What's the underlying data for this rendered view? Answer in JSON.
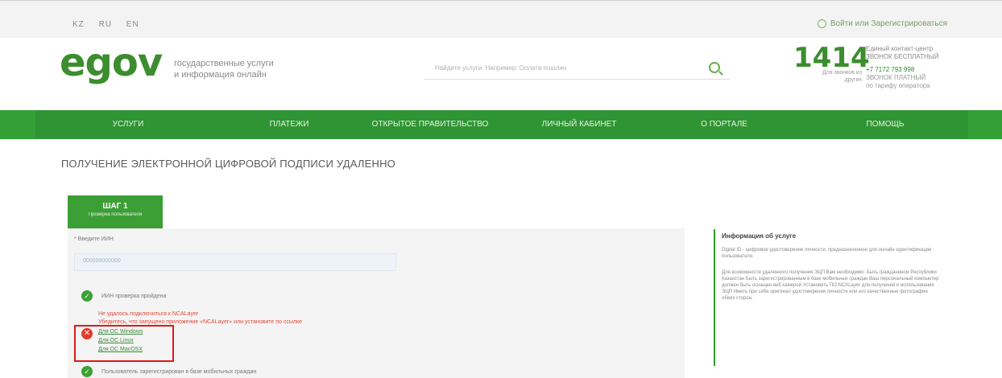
{
  "top": {
    "langs": [
      "KZ",
      "RU",
      "EN"
    ],
    "login": "Войти или Зарегистрироваться"
  },
  "header": {
    "logo_main": "egov",
    "tagline_1": "государственные услуги",
    "tagline_2": "и информация онлайн",
    "search_placeholder": "Найдите услуги. Например: Оплата пошлин",
    "phone": "1414",
    "phone_note_1": "Единый контакт-центр",
    "phone_note_2": "ЗВОНОК БЕСПЛАТНЫЙ",
    "phone_abroad_1": "Для звонков из",
    "phone_abroad_2": "других",
    "phone2": "+7 7172 793 998",
    "phone2_note_1": "ЗВОНОК ПЛАТНЫЙ",
    "phone2_note_2": "по тарифу оператора"
  },
  "nav": {
    "items": [
      "УСЛУГИ",
      "ПЛАТЕЖИ",
      "ОТКРЫТОЕ ПРАВИТЕЛЬСТВО",
      "ЛИЧНЫЙ КАБИНЕТ",
      "О ПОРТАЛЕ",
      "ПОМОЩЬ"
    ]
  },
  "page": {
    "title": "ПОЛУЧЕНИЕ ЭЛЕКТРОННОЙ ЦИФРОВОЙ ПОДПИСИ УДАЛЕННО",
    "step": "ШАГ 1",
    "step_sub": "Проверка пользователя"
  },
  "form": {
    "iin_label": "* Введите ИИН",
    "iin_value": "000000000000",
    "row1": "ИИН проверка пройдена",
    "err_1": "Не удалось подключиться к NCALayer",
    "err_2": "Убедитесь, что запущено приложение «NCALayer» или установите по ссылке",
    "link_windows": "Для ОС Windows",
    "link_linux": "Для ОС Linux",
    "link_mac": "Для ОС MacOSX",
    "row3": "Пользователь зарегистрирован в базе мобильных граждан"
  },
  "info": {
    "heading": "Информация об услуге",
    "p1": "Digital ID - цифровое удостоверение личности, предназначенное для онлайн идентификации пользователя.",
    "p2": "Для возможности удаленного получения ЭЦП Вам необходимо: Быть гражданином Республики Казахстан Быть зарегистрированным в базе мобильных граждан Ваш персональный компьютер должен быть оснащен веб камерой Установить ПО NCALayer для получения и использования ЭЦП Иметь при себе оригинал удостоверения личности или его качественные фотографии обеих сторон."
  }
}
